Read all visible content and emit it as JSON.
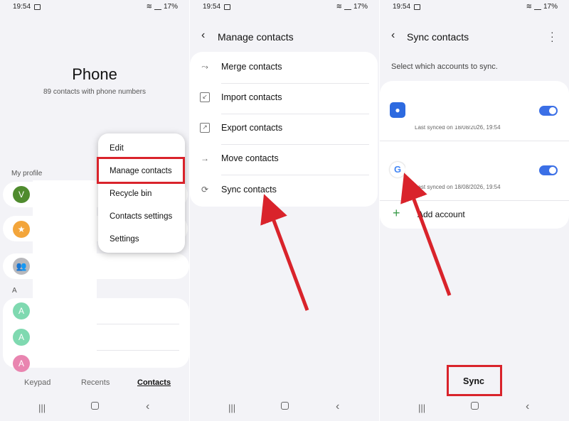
{
  "status": {
    "time": "19:54",
    "battery": "17%"
  },
  "panel1": {
    "title": "Phone",
    "subtitle": "89 contacts with phone numbers",
    "my_profile": "My profile",
    "section_a": "A",
    "avatars": [
      "V",
      "A",
      "A",
      "A"
    ],
    "menu": [
      "Edit",
      "Manage contacts",
      "Recycle bin",
      "Contacts settings",
      "Settings"
    ],
    "tabs": [
      "Keypad",
      "Recents",
      "Contacts"
    ]
  },
  "panel2": {
    "header": "Manage contacts",
    "items": [
      "Merge contacts",
      "Import contacts",
      "Export contacts",
      "Move contacts",
      "Sync contacts"
    ]
  },
  "panel3": {
    "header": "Sync contacts",
    "instruction": "Select which accounts to sync.",
    "account1_synced": "Last synced on 18/08/2026, 19:54",
    "account2_synced": "Last synced on 18/08/2026, 19:54",
    "add_account": "Add account",
    "sync_button": "Sync"
  },
  "colors": {
    "highlight": "#d9232b",
    "toggle": "#3b6fe6",
    "arrow": "#d9232b"
  }
}
